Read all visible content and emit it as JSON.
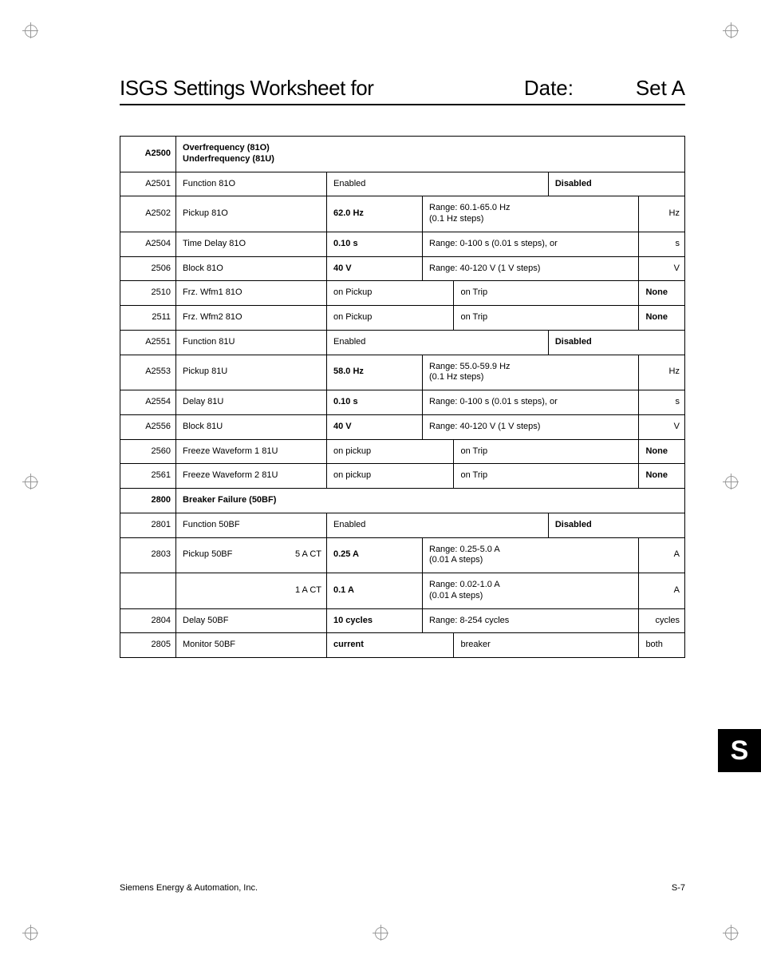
{
  "header": {
    "title": "ISGS Settings Worksheet for",
    "date_label": "Date:",
    "set_label": "Set A"
  },
  "section_a2500": {
    "id": "A2500",
    "title": "Overfrequency (81O)\nUnderfrequency (81U)"
  },
  "rows": {
    "a2501": {
      "id": "A2501",
      "desc": "Function 81O",
      "c1": "Enabled",
      "c2": "Disabled"
    },
    "a2502": {
      "id": "A2502",
      "desc": "Pickup 81O",
      "c1": "62.0 Hz",
      "range": "Range:  60.1-65.0 Hz\n(0.1 Hz steps)",
      "unit": "Hz"
    },
    "a2504": {
      "id": "A2504",
      "desc": "Time Delay 81O",
      "c1": "0.10 s",
      "range": "Range:  0-100 s  (0.01 s steps), or",
      "unit": "s"
    },
    "r2506": {
      "id": "2506",
      "desc": "Block 81O",
      "c1": "40 V",
      "range": "Range:  40-120 V (1 V steps)",
      "unit": "V"
    },
    "r2510": {
      "id": "2510",
      "desc": "Frz. Wfm1 81O",
      "c1": "on Pickup",
      "c2": "on Trip",
      "c3": "None"
    },
    "r2511": {
      "id": "2511",
      "desc": "Frz. Wfm2 81O",
      "c1": "on Pickup",
      "c2": "on Trip",
      "c3": "None"
    },
    "a2551": {
      "id": "A2551",
      "desc": "Function 81U",
      "c1": "Enabled",
      "c2": "Disabled"
    },
    "a2553": {
      "id": "A2553",
      "desc": "Pickup 81U",
      "c1": "58.0 Hz",
      "range": "Range:  55.0-59.9 Hz\n(0.1 Hz steps)",
      "unit": "Hz"
    },
    "a2554": {
      "id": "A2554",
      "desc": "Delay 81U",
      "c1": "0.10 s",
      "range": "Range:  0-100 s (0.01 s steps), or",
      "unit": "s"
    },
    "a2556": {
      "id": "A2556",
      "desc": "Block 81U",
      "c1": "40 V",
      "range": "Range:  40-120 V  (1 V steps)",
      "unit": "V"
    },
    "r2560": {
      "id": "2560",
      "desc": "Freeze Waveform 1 81U",
      "c1": "on pickup",
      "c2": "on Trip",
      "c3": "None"
    },
    "r2561": {
      "id": "2561",
      "desc": "Freeze Waveform 2 81U",
      "c1": "on pickup",
      "c2": "on Trip",
      "c3": "None"
    }
  },
  "section_2800": {
    "id": "2800",
    "title": "Breaker Failure (50BF)"
  },
  "rows_bf": {
    "r2801": {
      "id": "2801",
      "desc": "Function 50BF",
      "c1": "Enabled",
      "c2": "Disabled"
    },
    "r2803": {
      "id": "2803",
      "desc": "Pickup 50BF",
      "ct": "5 A CT",
      "c1": "0.25 A",
      "range": "Range:  0.25-5.0 A\n(0.01 A steps)",
      "unit": "A"
    },
    "r2803b": {
      "id": "",
      "desc": "",
      "ct": "1 A CT",
      "c1": "0.1 A",
      "range": "Range:  0.02-1.0 A\n(0.01 A steps)",
      "unit": "A"
    },
    "r2804": {
      "id": "2804",
      "desc": "Delay  50BF",
      "c1": "10 cycles",
      "range": "Range:  8-254 cycles",
      "unit": "cycles"
    },
    "r2805": {
      "id": "2805",
      "desc": "Monitor 50BF",
      "c1": "current",
      "c2": "breaker",
      "c3": "both"
    }
  },
  "side_tab": "S",
  "footer": {
    "left": "Siemens Energy & Automation, Inc.",
    "right": "S-7"
  }
}
